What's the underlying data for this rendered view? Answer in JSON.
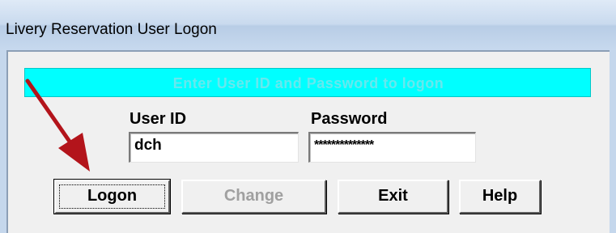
{
  "window": {
    "title": "Livery Reservation User Logon"
  },
  "banner": {
    "text": "Enter User ID and Password to logon",
    "background_color": "#00ffff",
    "text_color": "#67e8ee"
  },
  "form": {
    "user_id_label": "User ID",
    "user_id_value": "dch",
    "password_label": "Password",
    "password_value": "**************"
  },
  "buttons": {
    "logon_label": "Logon",
    "change_label": "Change",
    "exit_label": "Exit",
    "help_label": "Help"
  },
  "annotation": {
    "arrow_color": "#b3141b",
    "icon": "red-pointer-arrow-icon"
  }
}
